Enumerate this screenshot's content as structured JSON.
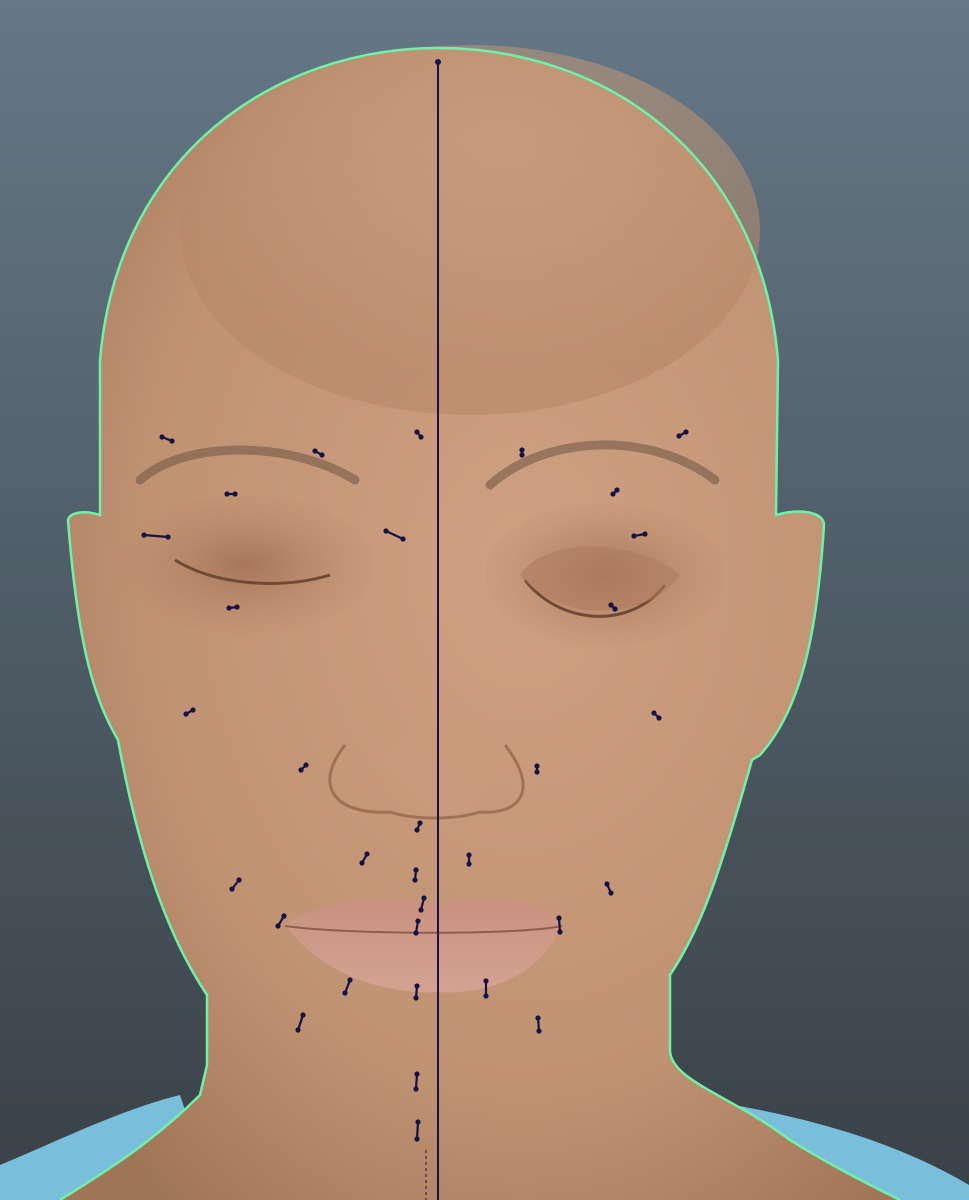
{
  "viewport": {
    "background_top": "#657886",
    "background_bottom": "#3a4147"
  },
  "model": {
    "skin_color": "#c59a78",
    "skin_shadow": "#a77b5c",
    "lip_color": "#c89586",
    "brow_color": "#6d5444",
    "shirt_color": "#79bfdc"
  },
  "overlay": {
    "selection_outline_color": "#6ff2a8",
    "guide_color": "#16124f",
    "control_color": "#141246",
    "controls_left": [
      "brow-outer",
      "brow-inner",
      "upper-lid",
      "eye-outer-corner",
      "eye-inner-corner",
      "lower-lid",
      "cheek",
      "nasolabial",
      "lip-corner",
      "chin-side",
      "jaw"
    ],
    "controls_right": [
      "brow-outer",
      "brow-inner",
      "upper-lid",
      "eye-outer-corner",
      "lower-lid",
      "cheek",
      "nasolabial",
      "lip-corner",
      "jaw"
    ],
    "controls_center": [
      "forehead-center",
      "nose-bridge",
      "philtrum",
      "upper-lip",
      "lip-seam",
      "lower-lip",
      "chin",
      "chin-lower"
    ]
  }
}
